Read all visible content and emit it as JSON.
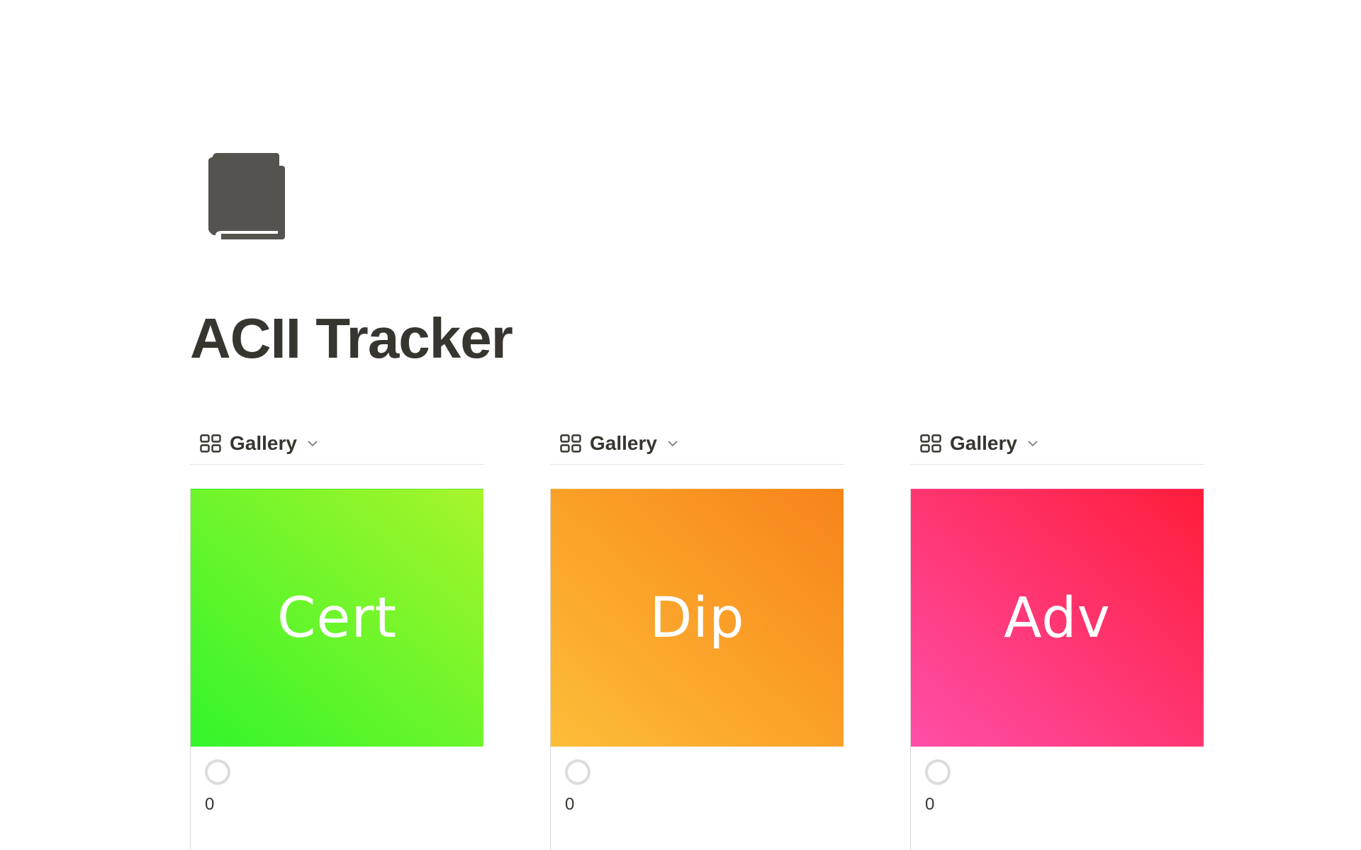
{
  "page": {
    "icon": "book-icon",
    "title": "ACII Tracker"
  },
  "views": [
    {
      "label": "Gallery",
      "icon": "gallery-grid-icon",
      "card": {
        "cover_text": "Cert",
        "cover_colors": [
          "#33f52b",
          "#a8f52b"
        ],
        "count": "0"
      }
    },
    {
      "label": "Gallery",
      "icon": "gallery-grid-icon",
      "card": {
        "cover_text": "Dip",
        "cover_colors": [
          "#fdbd38",
          "#f7841a"
        ],
        "count": "0"
      }
    },
    {
      "label": "Gallery",
      "icon": "gallery-grid-icon",
      "card": {
        "cover_text": "Adv",
        "cover_colors": [
          "#ff4ea8",
          "#ff1d3a"
        ],
        "count": "0"
      }
    }
  ],
  "colors": {
    "text": "#37352f",
    "icon": "#55534e",
    "divider": "#e3e2df"
  }
}
